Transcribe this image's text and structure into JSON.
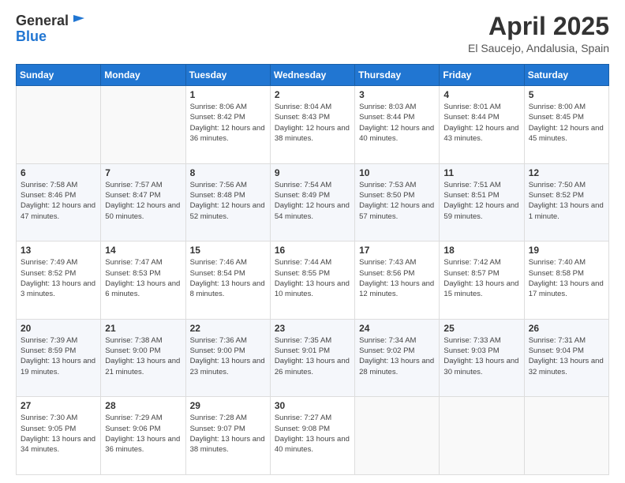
{
  "header": {
    "logo_line1": "General",
    "logo_line2": "Blue",
    "month": "April 2025",
    "location": "El Saucejo, Andalusia, Spain"
  },
  "weekdays": [
    "Sunday",
    "Monday",
    "Tuesday",
    "Wednesday",
    "Thursday",
    "Friday",
    "Saturday"
  ],
  "weeks": [
    [
      {
        "day": "",
        "info": ""
      },
      {
        "day": "",
        "info": ""
      },
      {
        "day": "1",
        "sunrise": "8:06 AM",
        "sunset": "8:42 PM",
        "daylight": "12 hours and 36 minutes."
      },
      {
        "day": "2",
        "sunrise": "8:04 AM",
        "sunset": "8:43 PM",
        "daylight": "12 hours and 38 minutes."
      },
      {
        "day": "3",
        "sunrise": "8:03 AM",
        "sunset": "8:44 PM",
        "daylight": "12 hours and 40 minutes."
      },
      {
        "day": "4",
        "sunrise": "8:01 AM",
        "sunset": "8:44 PM",
        "daylight": "12 hours and 43 minutes."
      },
      {
        "day": "5",
        "sunrise": "8:00 AM",
        "sunset": "8:45 PM",
        "daylight": "12 hours and 45 minutes."
      }
    ],
    [
      {
        "day": "6",
        "sunrise": "7:58 AM",
        "sunset": "8:46 PM",
        "daylight": "12 hours and 47 minutes."
      },
      {
        "day": "7",
        "sunrise": "7:57 AM",
        "sunset": "8:47 PM",
        "daylight": "12 hours and 50 minutes."
      },
      {
        "day": "8",
        "sunrise": "7:56 AM",
        "sunset": "8:48 PM",
        "daylight": "12 hours and 52 minutes."
      },
      {
        "day": "9",
        "sunrise": "7:54 AM",
        "sunset": "8:49 PM",
        "daylight": "12 hours and 54 minutes."
      },
      {
        "day": "10",
        "sunrise": "7:53 AM",
        "sunset": "8:50 PM",
        "daylight": "12 hours and 57 minutes."
      },
      {
        "day": "11",
        "sunrise": "7:51 AM",
        "sunset": "8:51 PM",
        "daylight": "12 hours and 59 minutes."
      },
      {
        "day": "12",
        "sunrise": "7:50 AM",
        "sunset": "8:52 PM",
        "daylight": "13 hours and 1 minute."
      }
    ],
    [
      {
        "day": "13",
        "sunrise": "7:49 AM",
        "sunset": "8:52 PM",
        "daylight": "13 hours and 3 minutes."
      },
      {
        "day": "14",
        "sunrise": "7:47 AM",
        "sunset": "8:53 PM",
        "daylight": "13 hours and 6 minutes."
      },
      {
        "day": "15",
        "sunrise": "7:46 AM",
        "sunset": "8:54 PM",
        "daylight": "13 hours and 8 minutes."
      },
      {
        "day": "16",
        "sunrise": "7:44 AM",
        "sunset": "8:55 PM",
        "daylight": "13 hours and 10 minutes."
      },
      {
        "day": "17",
        "sunrise": "7:43 AM",
        "sunset": "8:56 PM",
        "daylight": "13 hours and 12 minutes."
      },
      {
        "day": "18",
        "sunrise": "7:42 AM",
        "sunset": "8:57 PM",
        "daylight": "13 hours and 15 minutes."
      },
      {
        "day": "19",
        "sunrise": "7:40 AM",
        "sunset": "8:58 PM",
        "daylight": "13 hours and 17 minutes."
      }
    ],
    [
      {
        "day": "20",
        "sunrise": "7:39 AM",
        "sunset": "8:59 PM",
        "daylight": "13 hours and 19 minutes."
      },
      {
        "day": "21",
        "sunrise": "7:38 AM",
        "sunset": "9:00 PM",
        "daylight": "13 hours and 21 minutes."
      },
      {
        "day": "22",
        "sunrise": "7:36 AM",
        "sunset": "9:00 PM",
        "daylight": "13 hours and 23 minutes."
      },
      {
        "day": "23",
        "sunrise": "7:35 AM",
        "sunset": "9:01 PM",
        "daylight": "13 hours and 26 minutes."
      },
      {
        "day": "24",
        "sunrise": "7:34 AM",
        "sunset": "9:02 PM",
        "daylight": "13 hours and 28 minutes."
      },
      {
        "day": "25",
        "sunrise": "7:33 AM",
        "sunset": "9:03 PM",
        "daylight": "13 hours and 30 minutes."
      },
      {
        "day": "26",
        "sunrise": "7:31 AM",
        "sunset": "9:04 PM",
        "daylight": "13 hours and 32 minutes."
      }
    ],
    [
      {
        "day": "27",
        "sunrise": "7:30 AM",
        "sunset": "9:05 PM",
        "daylight": "13 hours and 34 minutes."
      },
      {
        "day": "28",
        "sunrise": "7:29 AM",
        "sunset": "9:06 PM",
        "daylight": "13 hours and 36 minutes."
      },
      {
        "day": "29",
        "sunrise": "7:28 AM",
        "sunset": "9:07 PM",
        "daylight": "13 hours and 38 minutes."
      },
      {
        "day": "30",
        "sunrise": "7:27 AM",
        "sunset": "9:08 PM",
        "daylight": "13 hours and 40 minutes."
      },
      {
        "day": "",
        "info": ""
      },
      {
        "day": "",
        "info": ""
      },
      {
        "day": "",
        "info": ""
      }
    ]
  ],
  "labels": {
    "sunrise": "Sunrise:",
    "sunset": "Sunset:",
    "daylight": "Daylight:"
  }
}
